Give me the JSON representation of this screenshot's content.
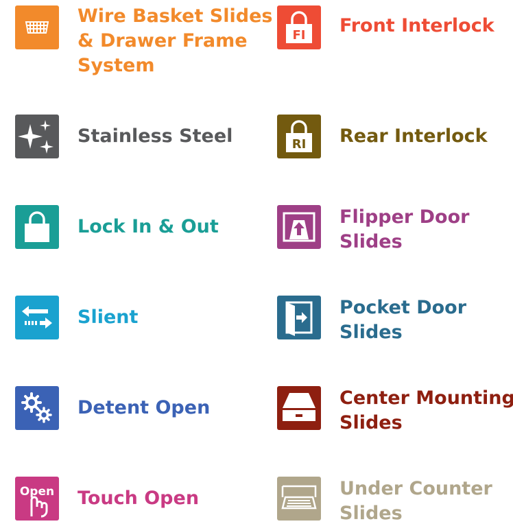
{
  "features": {
    "wire_basket": {
      "label_lines": [
        "Wire Basket Slides",
        "& Drawer Frame",
        "System"
      ],
      "color": "#f28a2b",
      "icon": "wire-basket-icon"
    },
    "stainless": {
      "label_lines": [
        "Stainless Steel"
      ],
      "color": "#58595b",
      "icon": "sparkle-icon"
    },
    "lock_in_out": {
      "label_lines": [
        "Lock In & Out"
      ],
      "color": "#1a9e96",
      "icon": "padlock-icon"
    },
    "slient": {
      "label_lines": [
        "Slient"
      ],
      "color": "#1aa2cf",
      "icon": "arrows-icon"
    },
    "detent_open": {
      "label_lines": [
        "Detent Open"
      ],
      "color": "#3b62b5",
      "icon": "gears-icon"
    },
    "touch_open": {
      "label_lines": [
        "Touch Open"
      ],
      "color": "#c93a83",
      "icon": "touch-open-icon",
      "icon_text": "Open"
    },
    "front_interlock": {
      "label_lines": [
        "Front Interlock"
      ],
      "color": "#ee4c35",
      "icon": "front-interlock-lock-icon",
      "icon_text": "FI"
    },
    "rear_interlock": {
      "label_lines": [
        "Rear Interlock"
      ],
      "color": "#735a0f",
      "icon": "rear-interlock-lock-icon",
      "icon_text": "RI"
    },
    "flipper_door": {
      "label_lines": [
        "Flipper Door",
        "Slides"
      ],
      "color": "#9e3f86",
      "icon": "flipper-door-icon"
    },
    "pocket_door": {
      "label_lines": [
        "Pocket Door",
        "Slides"
      ],
      "color": "#2a6c8e",
      "icon": "pocket-door-icon"
    },
    "center_mounting": {
      "label_lines": [
        "Center Mounting",
        "Slides"
      ],
      "color": "#8e1f10",
      "icon": "drawer-icon"
    },
    "under_counter": {
      "label_lines": [
        "Under Counter",
        "Slides"
      ],
      "color": "#b0a68b",
      "icon": "keyboard-tray-icon"
    }
  }
}
